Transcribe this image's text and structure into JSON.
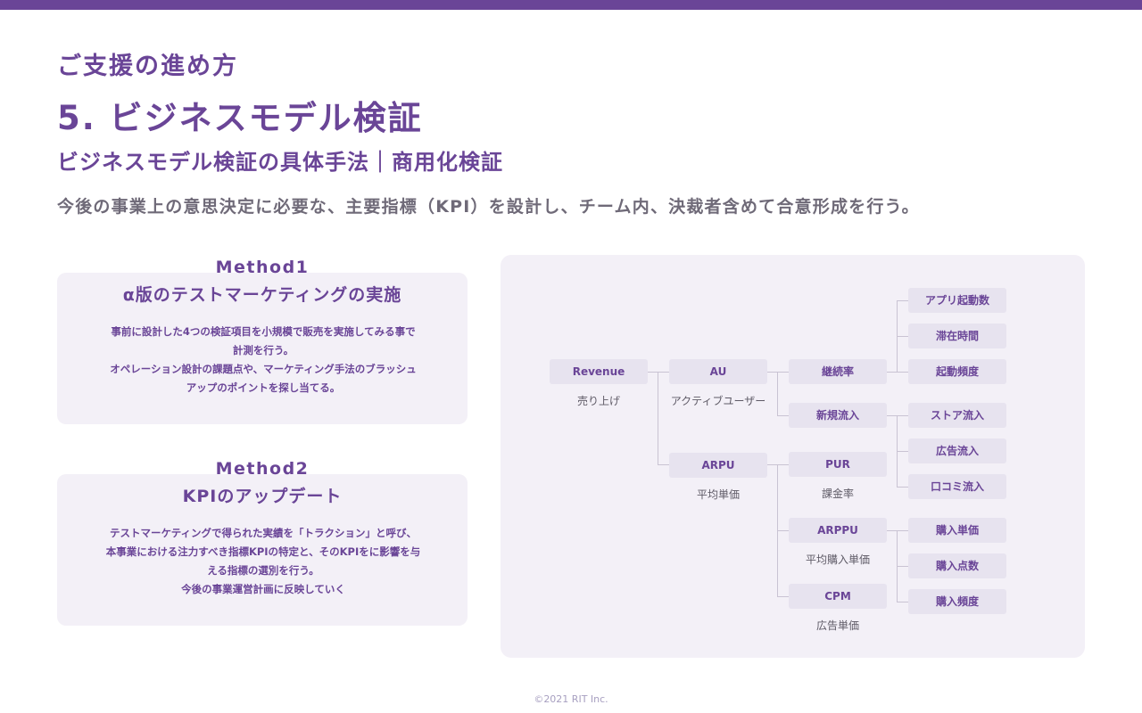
{
  "header": {
    "kicker": "ご支援の進め方",
    "title": "5. ビジネスモデル検証",
    "subtitle": "ビジネスモデル検証の具体手法｜商用化検証",
    "lead": "今後の事業上の意思決定に必要な、主要指標（KPI）を設計し、チーム内、決裁者含めて合意形成を行う。"
  },
  "methods": [
    {
      "label": "Method1",
      "heading": "α版のテストマーケティングの実施",
      "lines": [
        "事前に設計した4つの検証項目を小規模で販売を実施してみる事で",
        "計測を行う。",
        "オペレーション設計の課題点や、マーケティング手法のブラッシュ",
        "アップのポイントを探し当てる。"
      ]
    },
    {
      "label": "Method2",
      "heading": "KPIのアップデート",
      "lines": [
        "テストマーケティングで得られた実績を「トラクション」と呼び、",
        "本事業における注力すべき指標KPIの特定と、そのKPIをに影響を与",
        "える指標の選別を行う。",
        "今後の事業運営計画に反映していく"
      ]
    }
  ],
  "tree": {
    "revenue": {
      "label": "Revenue",
      "sub": "売り上げ"
    },
    "au": {
      "label": "AU",
      "sub": "アクティブユーザー"
    },
    "arpu": {
      "label": "ARPU",
      "sub": "平均単価"
    },
    "retention": {
      "label": "継続率"
    },
    "new_inflow": {
      "label": "新規流入"
    },
    "pur": {
      "label": "PUR",
      "sub": "課金率"
    },
    "arppu": {
      "label": "ARPPU",
      "sub": "平均購入単価"
    },
    "cpm": {
      "label": "CPM",
      "sub": "広告単価"
    },
    "app_launches": {
      "label": "アプリ起動数"
    },
    "stay_time": {
      "label": "滞在時間"
    },
    "launch_freq": {
      "label": "起動頻度"
    },
    "store_inflow": {
      "label": "ストア流入"
    },
    "ad_inflow": {
      "label": "広告流入"
    },
    "wom_inflow": {
      "label": "口コミ流入"
    },
    "purchase_unit": {
      "label": "購入単価"
    },
    "purchase_count": {
      "label": "購入点数"
    },
    "purchase_freq": {
      "label": "購入頻度"
    }
  },
  "footer": {
    "copyright": "©2021 RIT Inc."
  }
}
